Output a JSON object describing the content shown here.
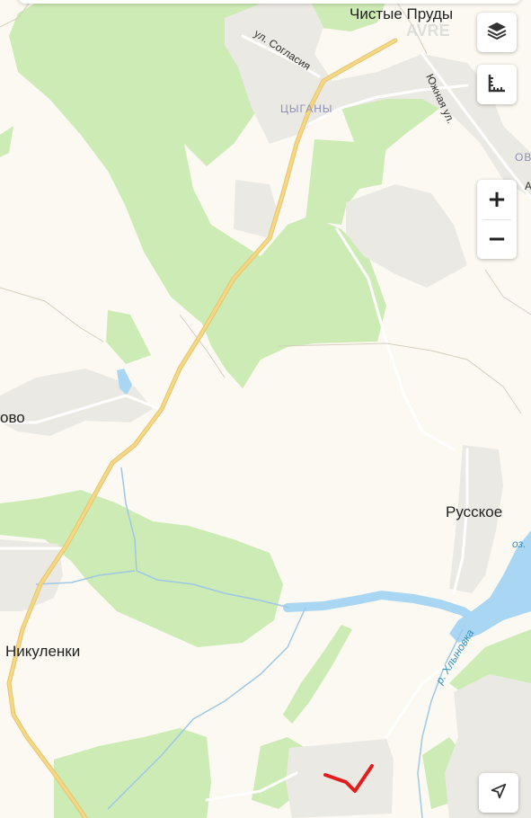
{
  "map": {
    "places": {
      "chistye_prudy": "Чистые Пруды",
      "tsygany": "ЦЫГАНЫ",
      "russkoe": "Русское",
      "nikulenki": "Никуленки",
      "ovo": "ово",
      "ov_partial": "ОВ",
      "a_partial": "А"
    },
    "streets": {
      "soglasiya": "ул. Согласия",
      "yuzhnaya": "Южная ул."
    },
    "water": {
      "khlynovka": "р. Хлыновка",
      "oz": "оз."
    },
    "watermark": "AVRE",
    "colors": {
      "background": "#fbf9f1",
      "forest": "#cdebb4",
      "water": "#a9d7f3",
      "road_major": "#f5d887",
      "marker": "#e11d1d"
    }
  },
  "controls": {
    "zoom_in": "+",
    "zoom_out": "−",
    "layers_icon": "layers-icon",
    "ruler_icon": "ruler-icon",
    "location_icon": "navigation-arrow-icon"
  }
}
